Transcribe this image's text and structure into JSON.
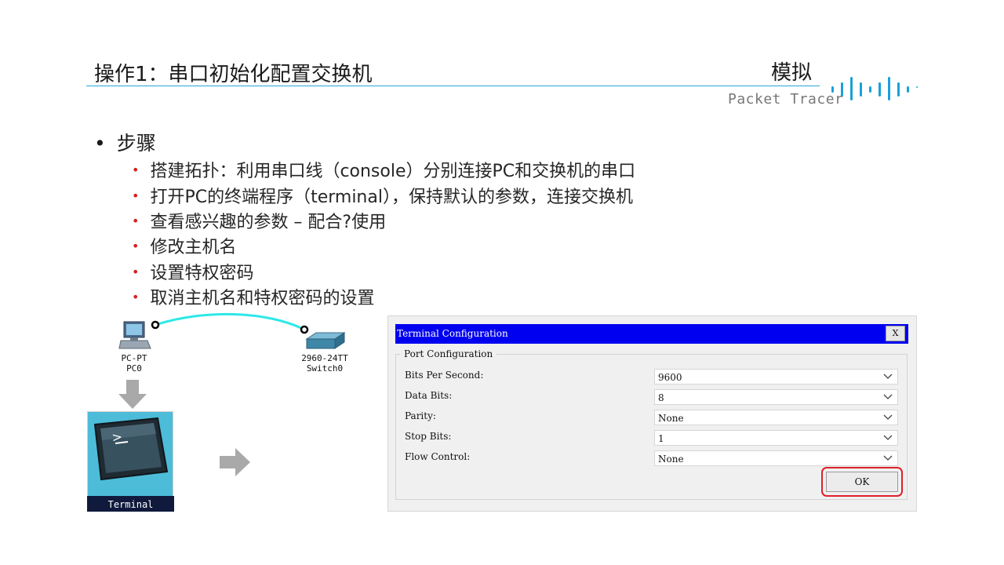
{
  "slide": {
    "title": "操作1：串口初始化配置交换机",
    "corner_label": "模拟",
    "brand": "Packet Tracer",
    "accent_color": "#2aa3d8",
    "bullet_color": "#d42020"
  },
  "steps": {
    "heading": "步骤",
    "items": [
      "搭建拓扑：利用串口线（console）分别连接PC和交换机的串口",
      "打开PC的终端程序（terminal），保持默认的参数，连接交换机",
      "查看感兴趣的参数 – 配合?使用",
      "修改主机名",
      "设置特权密码",
      "取消主机名和特权密码的设置"
    ]
  },
  "topology": {
    "pc": {
      "model": "PC-PT",
      "name": "PC0",
      "icon": "pc-icon"
    },
    "switch": {
      "model": "2960-24TT",
      "name": "Switch0",
      "icon": "switch-icon"
    },
    "link_color": "#2ee8e8"
  },
  "terminal_app": {
    "label": "Terminal",
    "icon": "terminal-monitor-icon"
  },
  "dialog": {
    "title": "Terminal Configuration",
    "close_label": "X",
    "group_label": "Port Configuration",
    "fields": [
      {
        "label": "Bits Per Second:",
        "value": "9600"
      },
      {
        "label": "Data Bits:",
        "value": "8"
      },
      {
        "label": "Parity:",
        "value": "None"
      },
      {
        "label": "Stop Bits:",
        "value": "1"
      },
      {
        "label": "Flow Control:",
        "value": "None"
      }
    ],
    "ok_label": "OK",
    "titlebar_color": "#0000f0",
    "highlight_color": "#e0202a"
  }
}
